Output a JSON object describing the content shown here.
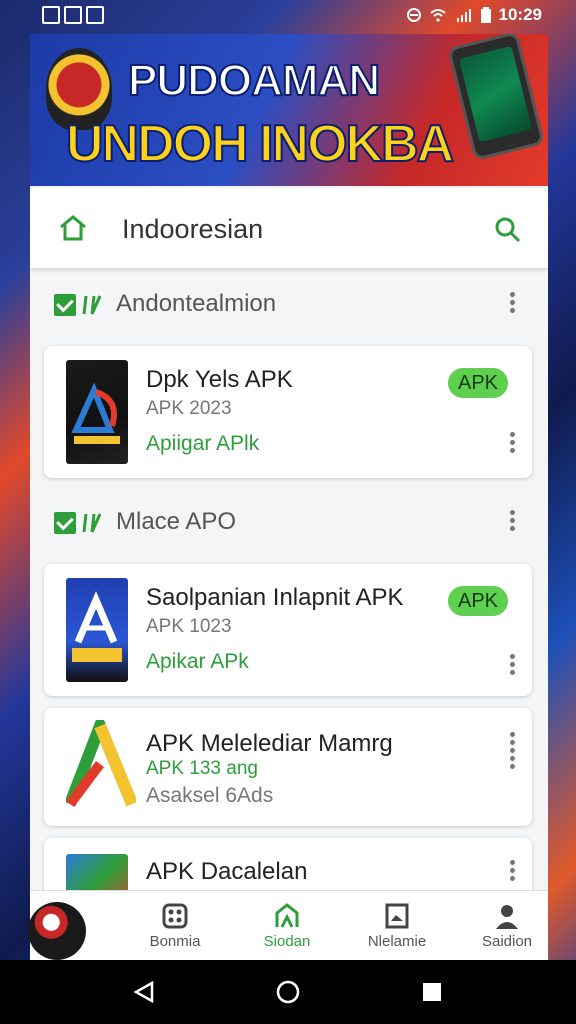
{
  "status_bar": {
    "time": "10:29"
  },
  "banner": {
    "line1": "PUDOAMAN",
    "line2": "UNDOH INOKBA"
  },
  "search": {
    "query": "Indooresian"
  },
  "sections": [
    {
      "title": "Andontealmion"
    },
    {
      "title": "Mlace APO"
    }
  ],
  "apps": [
    {
      "name": "Dpk Yels APK",
      "subtitle": "APK 2023",
      "link": "Apiigar APlk",
      "badge": "APK"
    },
    {
      "name": "Saolpanian Inlapnit APK",
      "subtitle": "APK 1023",
      "link": "Apikar APk",
      "badge": "APK"
    },
    {
      "name": "APK Melelediar Mamrg",
      "subtitle": "APK 133 ang",
      "link": "Asaksel 6Ads",
      "badge": ""
    },
    {
      "name": "APK Dacalelan",
      "subtitle": "",
      "link": "",
      "badge": ""
    }
  ],
  "bottom_nav": [
    {
      "label": "Bonmia"
    },
    {
      "label": "Siodan"
    },
    {
      "label": "Nlelamie"
    },
    {
      "label": "Saidion"
    }
  ],
  "colors": {
    "accent_green": "#2e9e3a",
    "pill_green": "#5fcf4f",
    "banner_yellow": "#ffd21a"
  },
  "icons": {
    "status": [
      "notification-icon",
      "do-not-disturb-icon",
      "wifi-icon",
      "signal-icon",
      "battery-icon"
    ],
    "system_nav": [
      "back-icon",
      "home-circle-icon",
      "recents-square-icon"
    ]
  }
}
